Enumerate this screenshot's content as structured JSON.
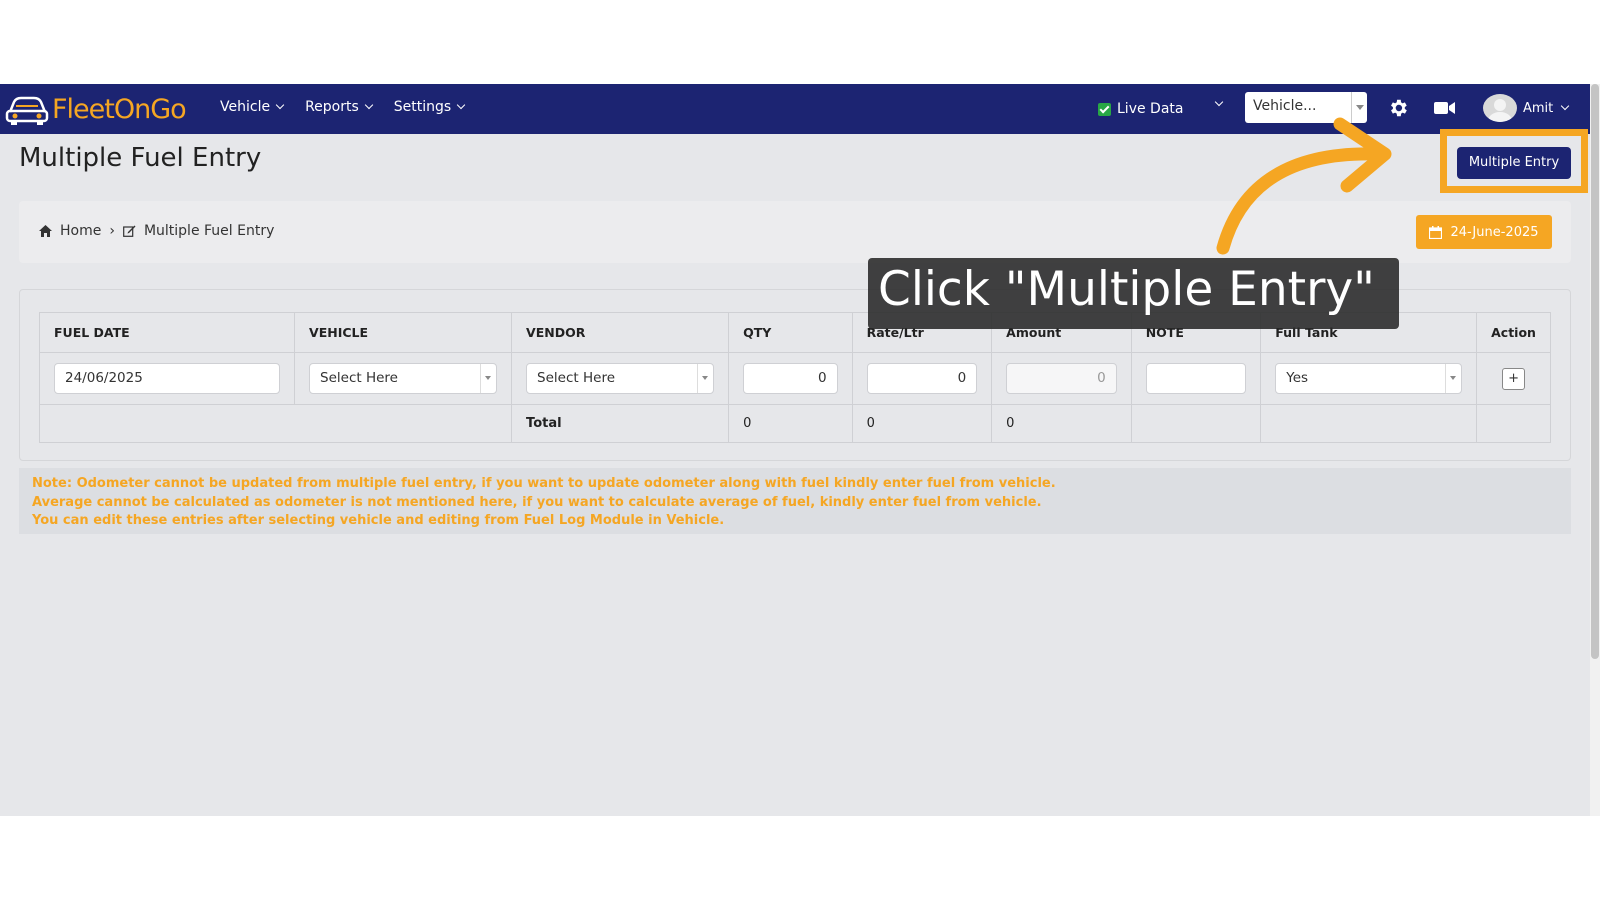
{
  "app": {
    "logo_text": "FleetOnGo",
    "colors": {
      "navbar": "#1c2472",
      "accent": "#f5a623",
      "background": "#e6e7ea"
    }
  },
  "navbar": {
    "menu": [
      {
        "label": "Vehicle"
      },
      {
        "label": "Reports"
      },
      {
        "label": "Settings"
      }
    ],
    "live_data_label": "Live Data",
    "vehicle_select": "Vehicle...",
    "user_name": "Amit",
    "icons": [
      "gear-icon",
      "video-camera-icon",
      "avatar"
    ]
  },
  "page": {
    "title": "Multiple Fuel Entry",
    "multiple_entry_button": "Multiple Entry"
  },
  "breadcrumb": {
    "home": "Home",
    "current": "Multiple Fuel Entry",
    "date": "24-June-2025"
  },
  "table": {
    "headers": [
      "FUEL DATE",
      "VEHICLE",
      "VENDOR",
      "QTY",
      "Rate/Ltr",
      "Amount",
      "NOTE",
      "Full Tank",
      "Action"
    ],
    "row": {
      "fuel_date": "24/06/2025",
      "vehicle": "Select Here",
      "vendor": "Select Here",
      "qty": "0",
      "rate": "0",
      "amount": "0",
      "note": "",
      "full_tank": "Yes",
      "action": "+"
    },
    "total": {
      "label": "Total",
      "qty": "0",
      "rate": "0",
      "amount": "0"
    }
  },
  "note": {
    "lines": [
      "Note: Odometer cannot be updated from multiple fuel entry, if you want to update odometer along with fuel kindly enter fuel from vehicle.",
      "Average cannot be calculated as odometer is not mentioned here, if you want to calculate average of fuel, kindly enter fuel from vehicle.",
      "You can edit these entries after selecting vehicle and editing from Fuel Log Module in Vehicle."
    ]
  },
  "callout": {
    "text": "Click \"Multiple Entry\""
  }
}
